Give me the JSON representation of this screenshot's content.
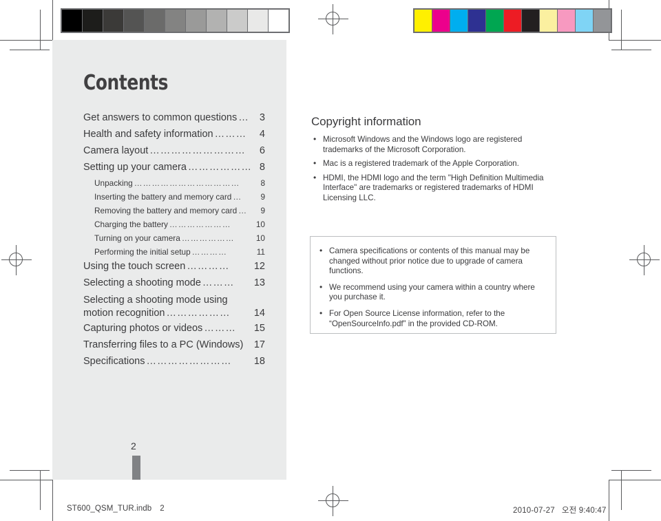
{
  "document": {
    "page_number": "2",
    "contents_heading": "Contents",
    "copyright_heading": "Copyright information"
  },
  "calibration": {
    "gray_strip_label": "grayscale-calibration-bar",
    "gray_swatches": [
      "#000000",
      "#1d1d1b",
      "#3b3a38",
      "#545453",
      "#6b6b6a",
      "#838382",
      "#9a9a99",
      "#b2b2b1",
      "#cbcbca",
      "#e9e9e8",
      "#ffffff"
    ],
    "color_strip_label": "color-calibration-bar",
    "color_swatches": [
      "#fff000",
      "#ec008c",
      "#00aeef",
      "#2e3192",
      "#00a651",
      "#ed1c24",
      "#231f20",
      "#fbf0a0",
      "#f799c0",
      "#7fd4f5",
      "#939598"
    ]
  },
  "toc": {
    "entries": [
      {
        "label": "Get answers to common questions",
        "leader": "…",
        "page": "3",
        "level": 1
      },
      {
        "label": "Health and safety information",
        "leader": "………",
        "page": "4",
        "level": 1
      },
      {
        "label": "Camera layout",
        "leader": "………………………",
        "page": "6",
        "level": 1
      },
      {
        "label": "Setting up your camera",
        "leader": "………………",
        "page": "8",
        "level": 1
      },
      {
        "label": "Unpacking",
        "leader": "………………………………",
        "page": "8",
        "level": 2
      },
      {
        "label": "Inserting the battery and memory card",
        "leader": "…",
        "page": "9",
        "level": 2
      },
      {
        "label": "Removing the battery and memory card",
        "leader": "…",
        "page": "9",
        "level": 2
      },
      {
        "label": "Charging the battery",
        "leader": "…………………",
        "page": "10",
        "level": 2
      },
      {
        "label": "Turning on your camera",
        "leader": "………………",
        "page": "10",
        "level": 2
      },
      {
        "label": "Performing the initial setup",
        "leader": "…………",
        "page": "11",
        "level": 2
      },
      {
        "label": "Using the touch screen",
        "leader": "…………",
        "page": "12",
        "level": 1
      },
      {
        "label": "Selecting a shooting mode",
        "leader": "………",
        "page": "13",
        "level": 1
      }
    ],
    "wrapped_entry": {
      "line1": "Selecting a shooting mode using",
      "line2": "motion recognition",
      "leader": "………………",
      "page": "14"
    },
    "entries_after": [
      {
        "label": "Capturing photos or videos",
        "leader": "………",
        "page": "15",
        "level": 1
      },
      {
        "label": "Transferring files to a PC (Windows)",
        "leader": "",
        "page": "17",
        "level": 1
      },
      {
        "label": "Specifications",
        "leader": "……………………",
        "page": "18",
        "level": 1
      }
    ]
  },
  "copyright": {
    "items": [
      "Microsoft Windows and the Windows logo are registered trademarks of the Microsoft Corporation.",
      "Mac is a registered trademark of the Apple Corporation.",
      "HDMI, the HDMI logo and the term \"High Definition Multimedia Interface\" are trademarks or registered trademarks of HDMI Licensing LLC."
    ]
  },
  "note_box": {
    "items": [
      "Camera specifications or contents of this manual may be changed without prior notice due to upgrade of camera functions.",
      "We recommend using your camera within a country where you purchase it.",
      "For Open Source License information, refer to the “OpenSourceInfo.pdf” in the provided CD-ROM."
    ]
  },
  "footer": {
    "file_name": "ST600_QSM_TUR.indb",
    "file_page": "2",
    "date": "2010-07-27",
    "time": "오전 9:40:47"
  }
}
